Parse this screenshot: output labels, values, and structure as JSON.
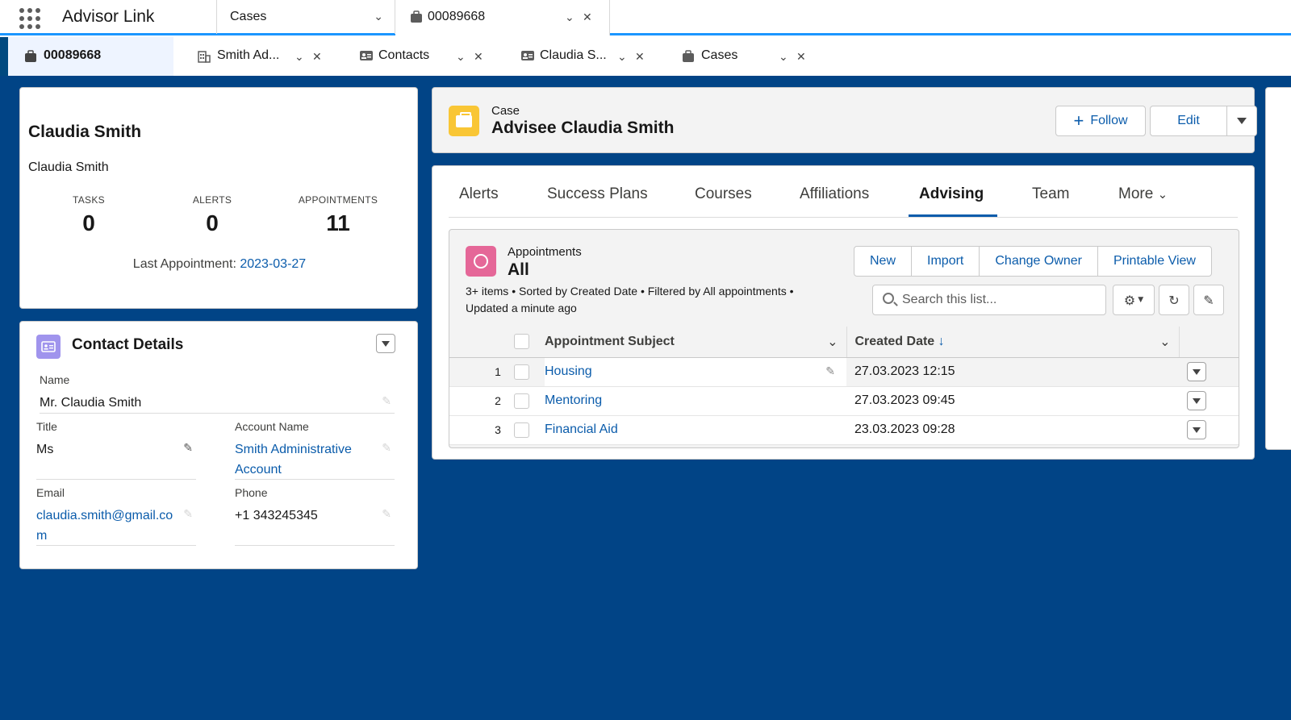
{
  "app": {
    "name": "Advisor Link"
  },
  "nav": {
    "selector_label": "Cases",
    "workspace_tab": "00089668"
  },
  "subtabs": [
    {
      "label": "00089668"
    },
    {
      "label": "Smith Ad..."
    },
    {
      "label": "Contacts"
    },
    {
      "label": "Claudia S..."
    },
    {
      "label": "Cases"
    }
  ],
  "profile": {
    "name": "Claudia Smith",
    "subtitle": "Claudia Smith",
    "stats": [
      {
        "label": "TASKS",
        "value": "0"
      },
      {
        "label": "ALERTS",
        "value": "0"
      },
      {
        "label": "APPOINTMENTS",
        "value": "11"
      }
    ],
    "last_appointment_label": "Last Appointment:",
    "last_appointment_value": "2023-03-27"
  },
  "contact": {
    "title": "Contact Details",
    "name_label": "Name",
    "name_value": "Mr. Claudia Smith",
    "title_label": "Title",
    "title_value": "Ms",
    "account_label": "Account Name",
    "account_value": "Smith Administrative Account",
    "email_label": "Email",
    "email_value": "claudia.smith@gmail.com",
    "phone_label": "Phone",
    "phone_value": "+1 343245345"
  },
  "case": {
    "object_label": "Case",
    "title": "Advisee Claudia Smith",
    "follow_label": "Follow",
    "edit_label": "Edit"
  },
  "tabs": [
    {
      "label": "Alerts"
    },
    {
      "label": "Success Plans"
    },
    {
      "label": "Courses"
    },
    {
      "label": "Affiliations"
    },
    {
      "label": "Advising"
    },
    {
      "label": "Team"
    },
    {
      "label": "More"
    }
  ],
  "list": {
    "object_label": "Appointments",
    "view_name": "All",
    "meta_line1": "3+ items • Sorted by Created Date • Filtered by All appointments •",
    "meta_line2": "Updated a minute ago",
    "buttons": [
      "New",
      "Import",
      "Change Owner",
      "Printable View"
    ],
    "search_placeholder": "Search this list...",
    "columns": {
      "subject": "Appointment Subject",
      "created": "Created Date"
    },
    "rows": [
      {
        "num": "1",
        "subject": "Housing",
        "created": "27.03.2023 12:15"
      },
      {
        "num": "2",
        "subject": "Mentoring",
        "created": "27.03.2023 09:45"
      },
      {
        "num": "3",
        "subject": "Financial Aid",
        "created": "23.03.2023 09:28"
      }
    ]
  },
  "colors": {
    "brand_blue": "#014486",
    "accent": "#1b96ff",
    "link": "#0b5cab",
    "case_icon": "#f9c635",
    "appointments_icon": "#e56798",
    "contact_icon": "#a094ed"
  }
}
